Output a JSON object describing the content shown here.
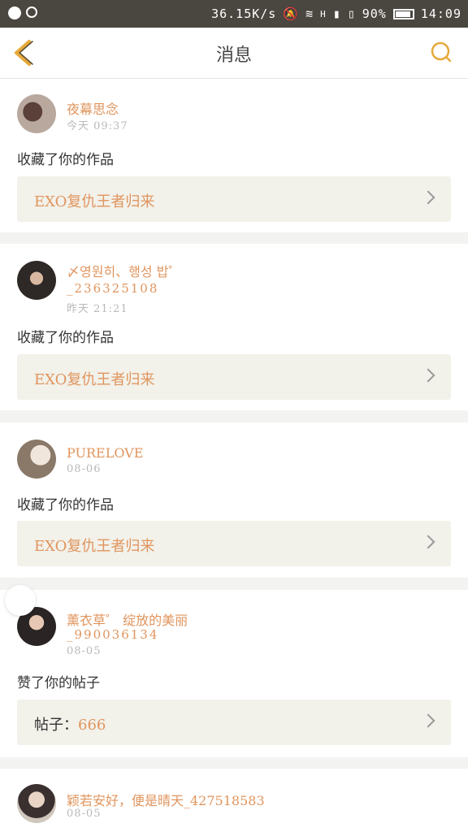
{
  "status": {
    "speed": "36.15K/s",
    "network": "H",
    "battery": "90%",
    "time": "14:09"
  },
  "header": {
    "title": "消息"
  },
  "messages": [
    {
      "name": "夜幕思念",
      "uid": "",
      "time": "今天 09:37",
      "action": "收藏了你的作品",
      "ref": "EXO复仇王者归来",
      "ref_prefix": ""
    },
    {
      "name": "〆영원히、행성 밥゜",
      "uid": "_236325108",
      "time": "昨天 21:21",
      "action": "收藏了你的作品",
      "ref": "EXO复仇王者归来",
      "ref_prefix": ""
    },
    {
      "name": "PURELOVE",
      "uid": "",
      "time": "08-06",
      "action": "收藏了你的作品",
      "ref": "EXO复仇王者归来",
      "ref_prefix": ""
    },
    {
      "name": "薰衣草゜ 绽放的美丽",
      "uid": "_990036134",
      "time": "08-05",
      "action": "赞了你的帖子",
      "ref": "666",
      "ref_prefix": "帖子："
    },
    {
      "name": "颖若安好，便是晴天_427518583",
      "uid": "",
      "time": "08-05",
      "action": "",
      "ref": "",
      "ref_prefix": ""
    }
  ],
  "colors": {
    "accent": "#e0955e",
    "back_arrow": "#e6a93a"
  }
}
